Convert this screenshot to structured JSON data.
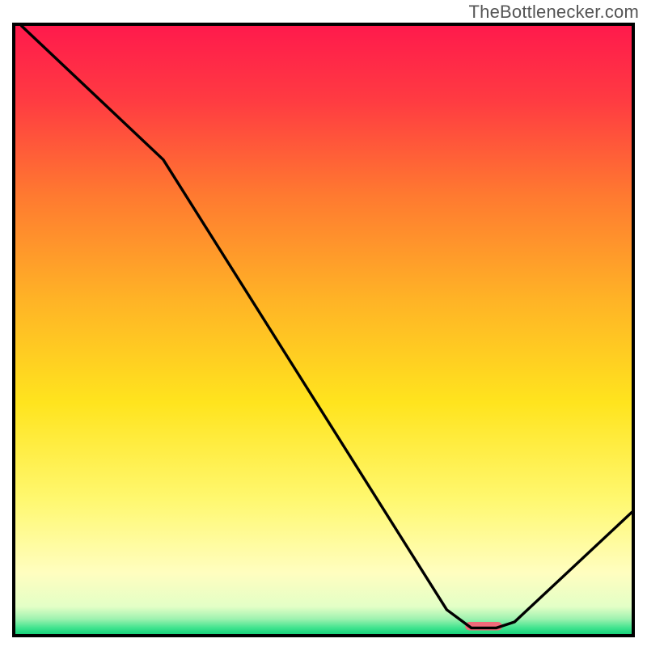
{
  "watermark": "TheBottlenecker.com",
  "chart_data": {
    "type": "line",
    "title": "",
    "xlabel": "",
    "ylabel": "",
    "xlim": [
      0,
      100
    ],
    "ylim": [
      0,
      100
    ],
    "legend": false,
    "grid": false,
    "background": {
      "type": "vertical_gradient",
      "stops": [
        {
          "pos": 0.0,
          "color": "#ff1a4c"
        },
        {
          "pos": 0.12,
          "color": "#ff3a42"
        },
        {
          "pos": 0.28,
          "color": "#ff7a30"
        },
        {
          "pos": 0.45,
          "color": "#ffb326"
        },
        {
          "pos": 0.62,
          "color": "#ffe41e"
        },
        {
          "pos": 0.78,
          "color": "#fff870"
        },
        {
          "pos": 0.9,
          "color": "#fffec0"
        },
        {
          "pos": 0.955,
          "color": "#e3ffc6"
        },
        {
          "pos": 0.975,
          "color": "#9ff2b0"
        },
        {
          "pos": 0.99,
          "color": "#3fe38e"
        },
        {
          "pos": 1.0,
          "color": "#18d37a"
        }
      ]
    },
    "curve": {
      "x": [
        1,
        24,
        70,
        74,
        78,
        81,
        100
      ],
      "y_pct": [
        100,
        78,
        4,
        1,
        1,
        2,
        20
      ]
    },
    "marker": {
      "x_pct": 76,
      "y_pct": 1.3,
      "width_pct": 6,
      "height_pct": 1.4,
      "color": "#f06a7a",
      "radius": 4
    }
  }
}
